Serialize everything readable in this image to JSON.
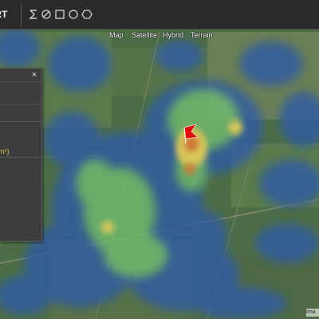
{
  "toolbar": {
    "export_label": "ORT",
    "tools": [
      "sigma-icon",
      "slashed-circle-icon",
      "square-icon",
      "circle-icon",
      "hexagon-icon"
    ]
  },
  "map_type_controls": [
    "Map",
    "Satellite",
    "Hybrid",
    "Terrain"
  ],
  "panel": {
    "close_label": "×",
    "visible_text": "m²)"
  },
  "marker": {
    "type": "flag",
    "color": "#e01010"
  },
  "attribution": "Ima",
  "colors": {
    "toolbar": "#2b2b2b",
    "heatmap_low": "#2d5aa8",
    "heatmap_mid": "#6fbf73",
    "heatmap_high": "#ffe060",
    "heatmap_peak": "#f07a30",
    "panel_text": "#d9b84a"
  }
}
